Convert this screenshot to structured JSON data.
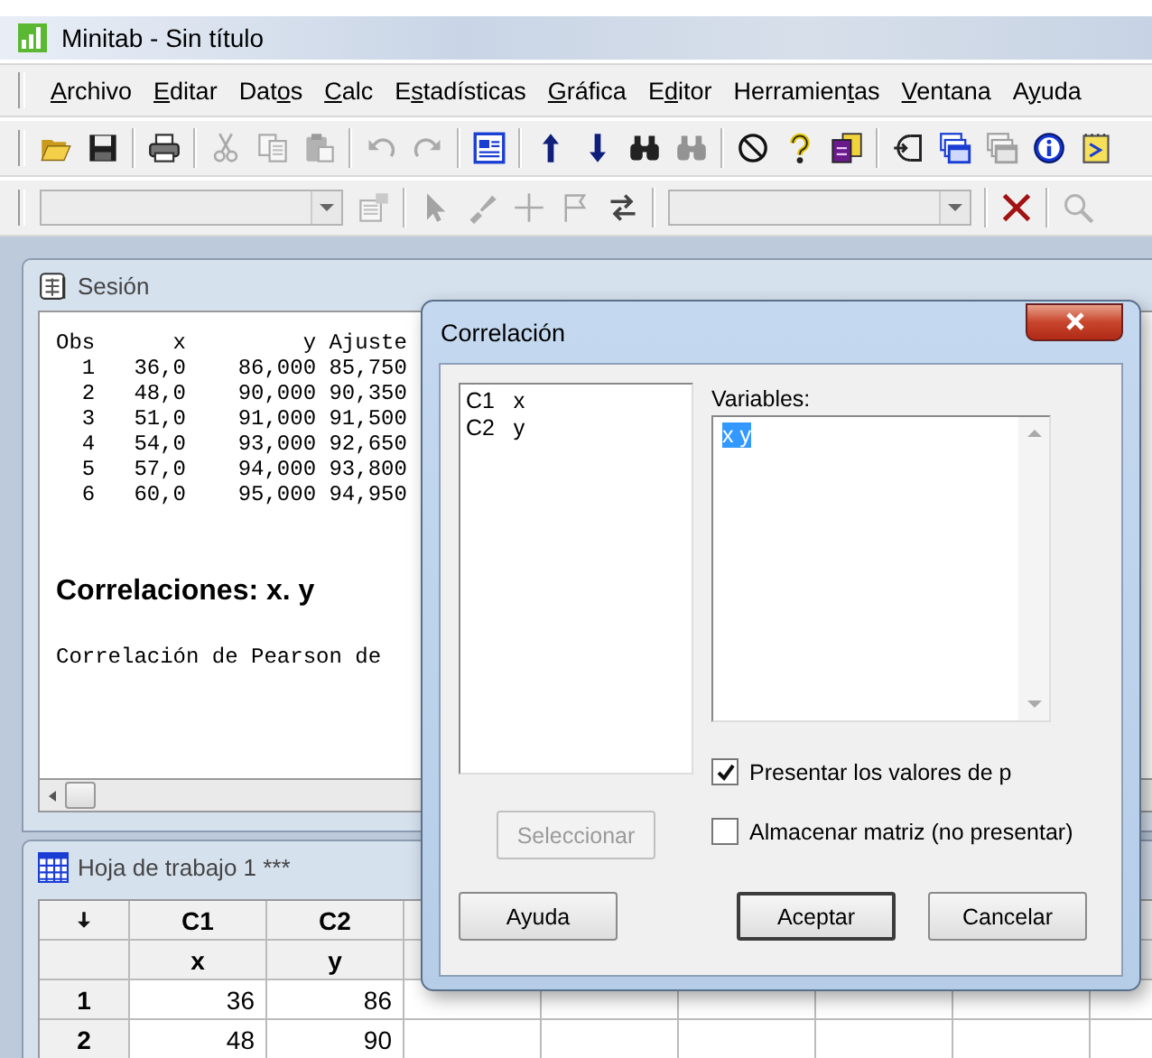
{
  "window": {
    "title": "Minitab - Sin título"
  },
  "menu": [
    {
      "key": "A",
      "post": "rchivo"
    },
    {
      "key": "E",
      "post": "ditar"
    },
    {
      "pre": "Dat",
      "key": "o",
      "post": "s"
    },
    {
      "key": "C",
      "post": "alc"
    },
    {
      "pre": "E",
      "key": "s",
      "post": "tadísticas"
    },
    {
      "key": "G",
      "post": "ráfica"
    },
    {
      "pre": "E",
      "key": "d",
      "post": "itor"
    },
    {
      "pre": "Herramien",
      "key": "t",
      "post": "as"
    },
    {
      "key": "V",
      "post": "entana"
    },
    {
      "pre": "A",
      "key": "y",
      "post": "uda"
    }
  ],
  "toolbar": {
    "groups": [
      {
        "items": [
          {
            "kind": "open",
            "disabled": false
          },
          {
            "kind": "save",
            "disabled": false
          }
        ]
      },
      {
        "items": [
          {
            "kind": "print",
            "disabled": false
          }
        ]
      },
      {
        "items": [
          {
            "kind": "cut",
            "disabled": true
          },
          {
            "kind": "copy",
            "disabled": true
          },
          {
            "kind": "paste",
            "disabled": true
          }
        ]
      },
      {
        "items": [
          {
            "kind": "undo",
            "disabled": true
          },
          {
            "kind": "redo",
            "disabled": true
          }
        ]
      },
      {
        "items": [
          {
            "kind": "worksheet",
            "disabled": false
          }
        ]
      },
      {
        "items": [
          {
            "kind": "up",
            "disabled": false
          },
          {
            "kind": "down",
            "disabled": false
          },
          {
            "kind": "find",
            "disabled": false
          },
          {
            "kind": "replace",
            "disabled": true
          }
        ]
      },
      {
        "items": [
          {
            "kind": "cancel",
            "disabled": false
          },
          {
            "kind": "help",
            "disabled": false
          },
          {
            "kind": "project",
            "disabled": false
          }
        ]
      },
      {
        "items": [
          {
            "kind": "insert",
            "disabled": false
          },
          {
            "kind": "graphs",
            "disabled": false
          },
          {
            "kind": "graphs",
            "disabled": true
          },
          {
            "kind": "info",
            "disabled": false
          },
          {
            "kind": "command",
            "disabled": false
          }
        ]
      }
    ]
  },
  "toolbar_2": {
    "groups": [
      {
        "items": [
          {
            "kind": "combo",
            "disabled": true
          },
          {
            "kind": "properties",
            "disabled": true
          }
        ]
      },
      {
        "items": [
          {
            "kind": "pointer",
            "disabled": true
          },
          {
            "kind": "brush",
            "disabled": true
          },
          {
            "kind": "crosshair",
            "disabled": true
          },
          {
            "kind": "flag",
            "disabled": true
          },
          {
            "kind": "swap",
            "disabled": false
          }
        ]
      },
      {
        "items": [
          {
            "kind": "combo",
            "disabled": true
          }
        ]
      },
      {
        "items": [
          {
            "kind": "delete",
            "disabled": false
          }
        ]
      },
      {
        "items": [
          {
            "kind": "zoom",
            "disabled": true
          }
        ]
      }
    ]
  },
  "session": {
    "title": "Sesión",
    "lines": [
      "Obs      x         y Ajuste",
      "  1   36,0    86,000 85,750",
      "  2   48,0    90,000 90,350",
      "  3   51,0    91,000 91,500",
      "  4   54,0    93,000 92,650",
      "  5   57,0    94,000 93,800",
      "  6   60,0    95,000 94,950"
    ],
    "heading": "Correlaciones: x. y",
    "text": "Correlación de Pearson de"
  },
  "worksheet": {
    "title": "Hoja de trabajo 1 ***",
    "columns": [
      {
        "id": "C1",
        "name": "x"
      },
      {
        "id": "C2",
        "name": "y"
      }
    ],
    "rows": [
      {
        "label": "1",
        "cells": [
          "36",
          "86"
        ]
      },
      {
        "label": "2",
        "cells": [
          "48",
          "90"
        ]
      }
    ]
  },
  "dialog": {
    "title": "Correlación",
    "columns_list": [
      {
        "label": "C1   x",
        "selected": false
      },
      {
        "label": "C2   y",
        "selected": false
      }
    ],
    "variables_label": "Variables:",
    "variables_value": "x y",
    "variables_value_selected": true,
    "select_button": {
      "label": "Seleccionar",
      "disabled": true
    },
    "checkboxes": [
      {
        "label": "Presentar los valores de p",
        "checked": true
      },
      {
        "label": "Almacenar matriz (no presentar)",
        "checked": false
      }
    ],
    "buttons": [
      {
        "label": "Ayuda",
        "default": false
      },
      {
        "label": "Aceptar",
        "default": true
      },
      {
        "label": "Cancelar",
        "default": false
      }
    ]
  }
}
